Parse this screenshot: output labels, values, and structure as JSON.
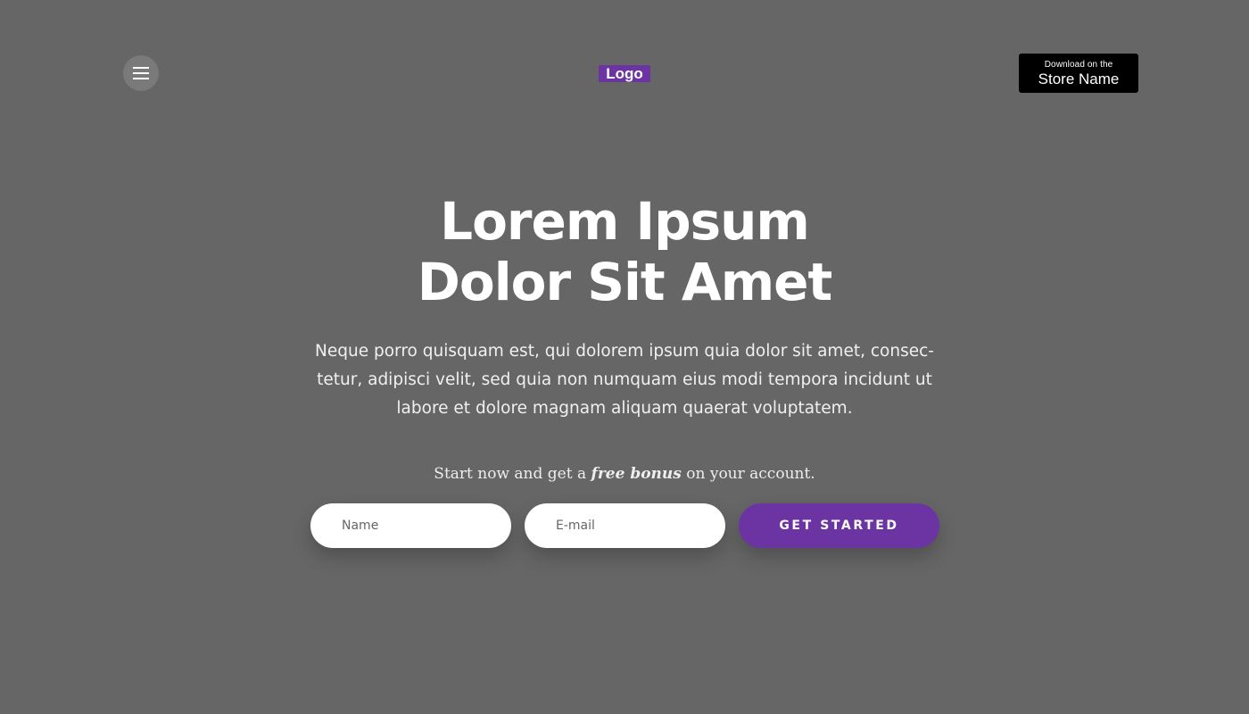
{
  "header": {
    "menu_icon": "hamburger-menu-icon",
    "logo_text": "Logo",
    "store_badge": {
      "small_text": "Download on the",
      "large_text": "Store Name"
    }
  },
  "hero": {
    "title_line_1": "Lorem Ipsum",
    "title_line_2": "Dolor Sit Amet",
    "description": "Neque porro quisquam est, qui dolorem ipsum quia dolor sit amet, consec­tetur, adipisci velit, sed quia non numquam eius modi tempora incidunt ut labore et dolore magnam aliquam quaerat voluptatem.",
    "bonus_prefix": "Start now and get a",
    "bonus_emphasis": "free bonus",
    "bonus_suffix": "on your account."
  },
  "signup_form": {
    "name_placeholder": "Name",
    "email_placeholder": "E-mail",
    "submit_label": "GET STARTED"
  },
  "colors": {
    "background": "#666666",
    "accent": "#6b34a2",
    "badge_background": "#000000",
    "field_background": "#ffffff"
  }
}
